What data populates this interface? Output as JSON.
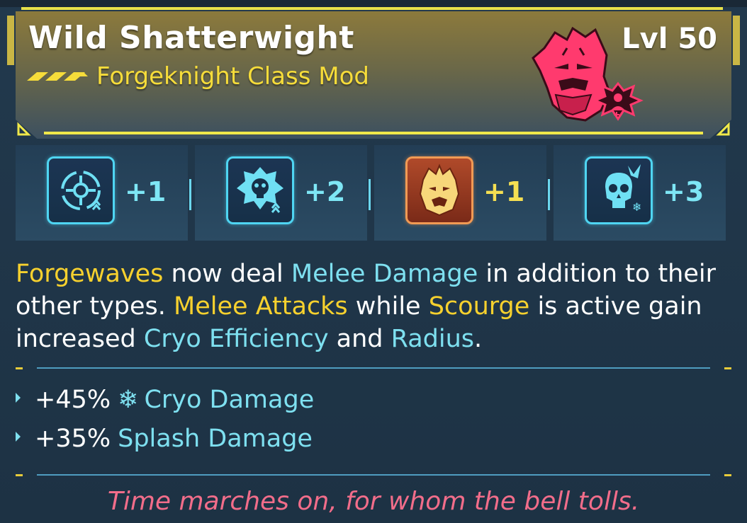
{
  "item": {
    "name": "Wild Shatterwight",
    "type": "Forgeknight Class Mod",
    "level": "Lvl 50",
    "rarity_icon": "rarity-chevrons-icon",
    "portrait_icon": "forgeknight-portrait-icon"
  },
  "skills": [
    {
      "icon": "crosshair-reload-icon",
      "value": "+1",
      "style": "blue"
    },
    {
      "icon": "cryo-skull-icon",
      "value": "+2",
      "style": "blue"
    },
    {
      "icon": "forge-face-icon",
      "value": "+1",
      "style": "orange"
    },
    {
      "icon": "frozen-skull-icon",
      "value": "+3",
      "style": "blue"
    }
  ],
  "description": {
    "p1": "Forgewaves",
    "p2": " now deal ",
    "p3": "Melee Damage",
    "p4": " in addition to their other types. ",
    "p5": "Melee Attacks",
    "p6": " while ",
    "p7": "Scourge",
    "p8": " is active gain increased ",
    "p9": "Cryo Efficiency",
    "p10": " and ",
    "p11": "Radius",
    "p12": "."
  },
  "stats": [
    {
      "value": "+45%",
      "icon": "snowflake-icon",
      "label": "Cryo Damage"
    },
    {
      "value": "+35%",
      "label": "Splash Damage"
    }
  ],
  "flavor_text": "Time marches on, for whom the bell tolls.",
  "colors": {
    "accent_yellow": "#f7d12e",
    "accent_cyan": "#7ee0f0",
    "flavor_pink": "#f26d8a",
    "portrait_red": "#ff3a6e"
  }
}
